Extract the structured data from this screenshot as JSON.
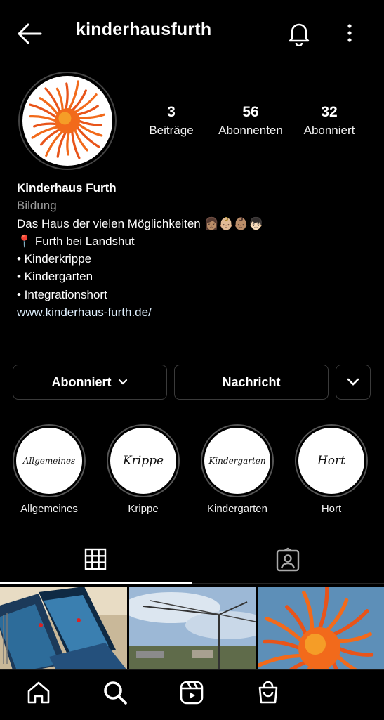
{
  "header": {
    "username": "kinderhausfurth",
    "icons": [
      "back-arrow-icon",
      "bell-icon",
      "more-vertical-icon"
    ]
  },
  "profile": {
    "stats": [
      {
        "value": "3",
        "label": "Beiträge"
      },
      {
        "value": "56",
        "label": "Abonnenten"
      },
      {
        "value": "32",
        "label": "Abonniert"
      }
    ],
    "name": "Kinderhaus Furth",
    "category": "Bildung",
    "bio_lines": [
      "Das Haus der vielen Möglichkeiten 👩🏽👶🏼👶🏽👦🏻",
      "📍 Furth bei Landshut",
      "• Kinderkrippe",
      "• Kindergarten",
      "• Integrationshort"
    ],
    "website": "www.kinderhaus-furth.de/"
  },
  "actions": {
    "follow_label": "Abonniert",
    "message_label": "Nachricht"
  },
  "highlights": [
    {
      "label": "Allgemeines",
      "cover_text": "Allgemeines"
    },
    {
      "label": "Krippe",
      "cover_text": "Krippe"
    },
    {
      "label": "Kindergarten",
      "cover_text": "Kindergarten"
    },
    {
      "label": "Hort",
      "cover_text": "Hort"
    }
  ],
  "tabs": [
    "grid-icon",
    "tagged-icon"
  ],
  "bottom_nav": [
    "home-icon",
    "search-icon",
    "reels-icon",
    "shop-icon"
  ],
  "colors": {
    "background": "#000000",
    "sun_orange": "#f26a1b",
    "sun_yellow": "#f7b42c",
    "border": "#3b3b3b"
  }
}
